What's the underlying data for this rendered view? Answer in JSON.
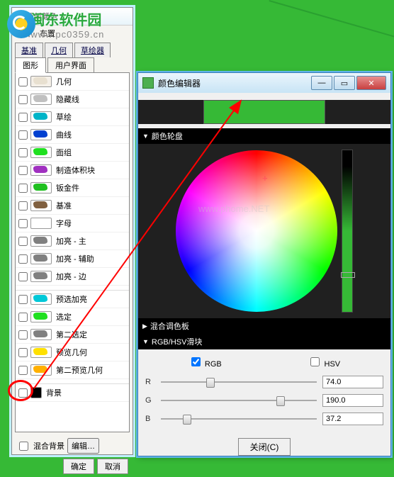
{
  "watermark": {
    "text1": "闽东软件园",
    "text2": "www.pc0359.cn",
    "center": "www.phome.NET"
  },
  "win1": {
    "title": "至新颜色",
    "menu": {
      "file": "文件",
      "arrange": "布置"
    },
    "tabs1": [
      "基准",
      "几何",
      "草绘器"
    ],
    "tabs2": [
      "图形",
      "用户界面"
    ],
    "items": [
      {
        "label": "几何",
        "color": "#f5f0e8",
        "sq": "#e8e0d0"
      },
      {
        "label": "隐藏线",
        "color": "#fff",
        "sq": "#c0c0c0"
      },
      {
        "label": "草绘",
        "color": "#fff",
        "sq": "#00b4c8"
      },
      {
        "label": "曲线",
        "color": "#fff",
        "sq": "#0040d0"
      },
      {
        "label": "面组",
        "color": "#fff",
        "sq": "#20e020"
      },
      {
        "label": "制造体积块",
        "color": "#fff",
        "sq": "#a030c0"
      },
      {
        "label": "钣金件",
        "color": "#fff",
        "sq": "#20c020"
      },
      {
        "label": "基准",
        "color": "#fff",
        "sq": "#806040"
      },
      {
        "label": "字母",
        "color": "#fff",
        "sq": "#fff"
      },
      {
        "label": "加亮 - 主",
        "color": "#fff",
        "sq": "#808080"
      },
      {
        "label": "加亮 - 辅助",
        "color": "#fff",
        "sq": "#808080"
      },
      {
        "label": "加亮 - 边",
        "color": "#fff",
        "sq": "#808080"
      },
      {
        "label": "预选加亮",
        "color": "#fff",
        "sq": "#00c8d8"
      },
      {
        "label": "选定",
        "color": "#fff",
        "sq": "#20e020"
      },
      {
        "label": "第二选定",
        "color": "#fff",
        "sq": "#808080"
      },
      {
        "label": "预览几何",
        "color": "#fff",
        "sq": "#ffe000"
      },
      {
        "label": "第二预览几何",
        "color": "#fff",
        "sq": "#ffb000"
      },
      {
        "label": "背景",
        "color": "#fff",
        "sq": "#20d020",
        "box": "#000"
      }
    ],
    "mixbg": "混合背景",
    "edit": "编辑…",
    "ok": "确定",
    "cancel": "取消"
  },
  "win2": {
    "title": "颜色编辑器",
    "wheel_hdr": "颜色轮盘",
    "mix_hdr": "混合调色板",
    "rgbhsv_hdr": "RGB/HSV滑块",
    "rgb": "RGB",
    "hsv": "HSV",
    "r": "R",
    "g": "G",
    "b": "B",
    "rv": "74.0",
    "gv": "190.0",
    "bv": "37.2",
    "close": "关闭(C)"
  }
}
